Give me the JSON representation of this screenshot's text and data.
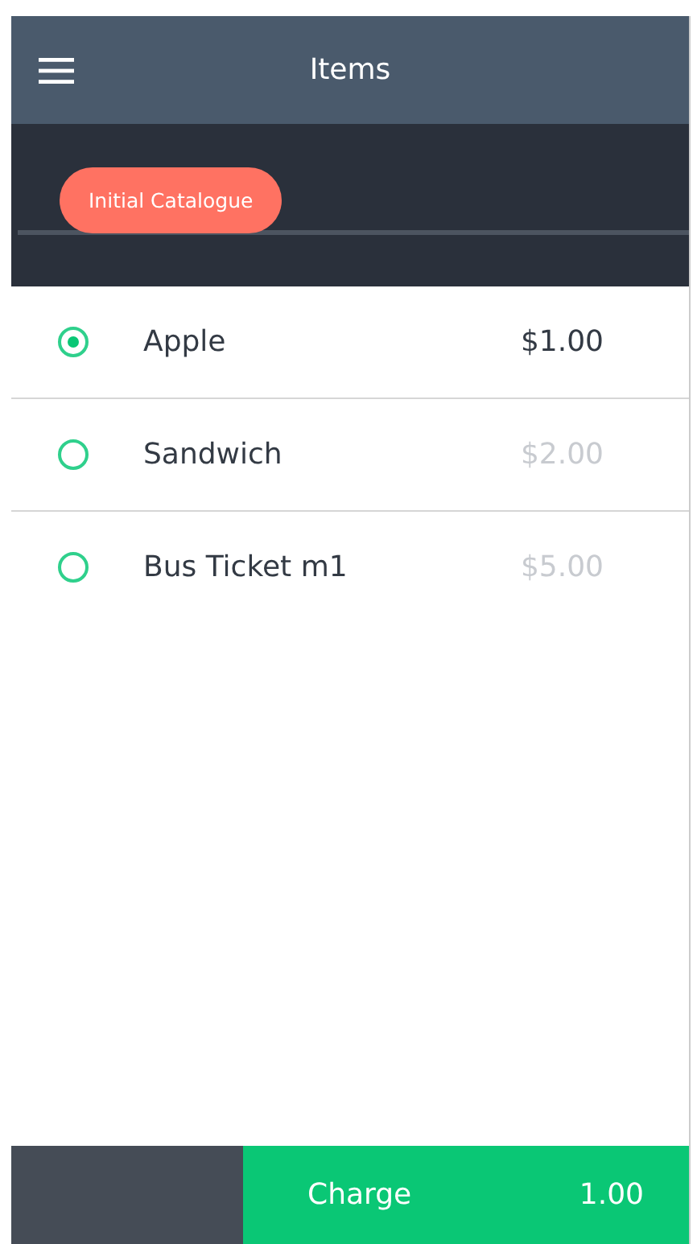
{
  "header": {
    "title": "Items"
  },
  "catalogue": {
    "label": "Initial Catalogue"
  },
  "items": [
    {
      "name": "Apple",
      "price": "$1.00",
      "selected": true
    },
    {
      "name": "Sandwich",
      "price": "$2.00",
      "selected": false
    },
    {
      "name": "Bus Ticket m1",
      "price": "$5.00",
      "selected": false
    }
  ],
  "footer": {
    "label": "Charge",
    "amount": "1.00"
  }
}
